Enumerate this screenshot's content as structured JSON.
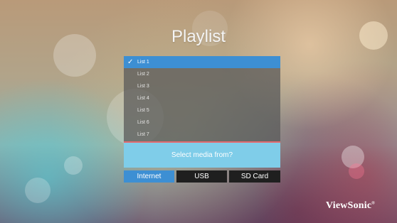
{
  "title": "Playlist",
  "playlists": [
    {
      "label": "List 1",
      "selected": true
    },
    {
      "label": "List 2",
      "selected": false
    },
    {
      "label": "List 3",
      "selected": false
    },
    {
      "label": "List 4",
      "selected": false
    },
    {
      "label": "List 5",
      "selected": false
    },
    {
      "label": "List 6",
      "selected": false
    },
    {
      "label": "List 7",
      "selected": false
    }
  ],
  "check_icon": "checkmark-icon",
  "prompt": "Select media from?",
  "sources": {
    "internet": "Internet",
    "usb": "USB",
    "sd_card": "SD Card"
  },
  "brand": "ViewSonic",
  "colors": {
    "selected": "#3d8fd3",
    "prompt_bg": "#7fcde9",
    "button_bg": "#1f1f1f",
    "divider": "#e46a6f"
  }
}
